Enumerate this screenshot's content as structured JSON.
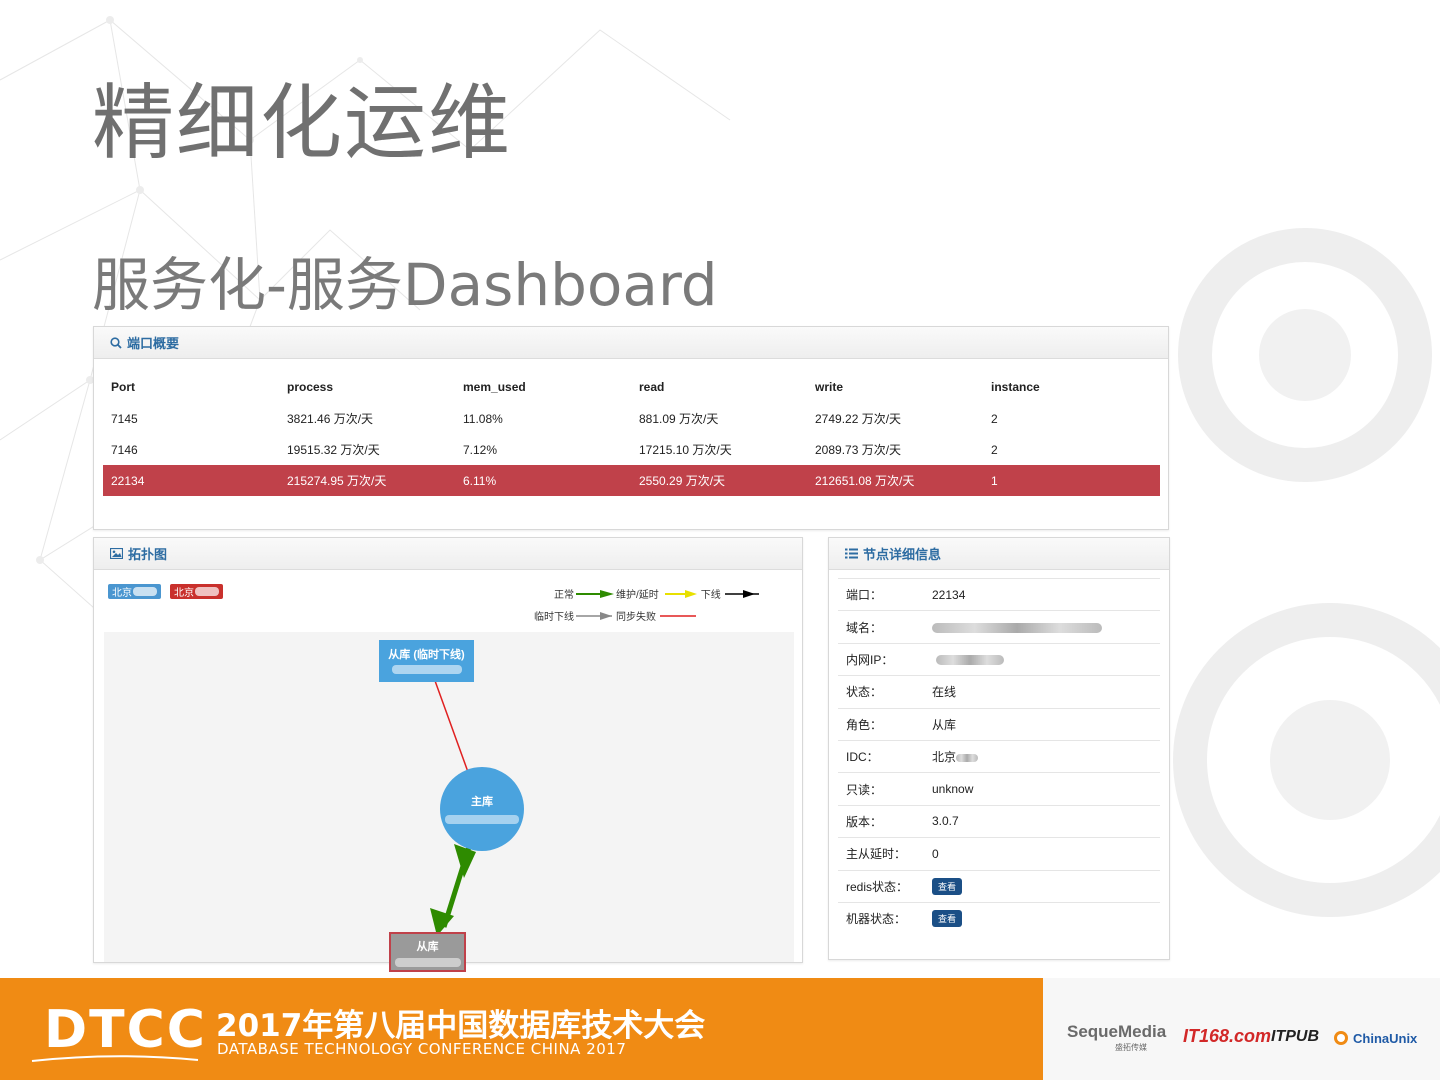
{
  "slide": {
    "title": "精细化运维",
    "subtitle": "服务化-服务Dashboard"
  },
  "port_panel": {
    "heading": "端口概要",
    "columns": [
      "Port",
      "process",
      "mem_used",
      "read",
      "write",
      "instance"
    ],
    "rows": [
      [
        "7145",
        "3821.46 万次/天",
        "11.08%",
        "881.09 万次/天",
        "2749.22 万次/天",
        "2"
      ],
      [
        "7146",
        "19515.32 万次/天",
        "7.12%",
        "17215.10 万次/天",
        "2089.73 万次/天",
        "2"
      ],
      [
        "22134",
        "215274.95 万次/天",
        "6.11%",
        "2550.29 万次/天",
        "212651.08 万次/天",
        "1"
      ]
    ],
    "highlight_color": "#c0414a"
  },
  "topology_panel": {
    "heading": "拓扑图",
    "tags": [
      {
        "label": "北京",
        "color": "#4a96d0"
      },
      {
        "label": "北京",
        "color": "#c9302c"
      }
    ],
    "legend": {
      "normal": "正常",
      "maintenance": "维护/延时",
      "offline": "下线",
      "temp_offline": "临时下线",
      "sync_fail": "同步失败"
    },
    "nodes": {
      "slave_temp": "从库 (临时下线)",
      "master": "主库",
      "slave": "从库"
    },
    "colors": {
      "normal": "#2e8b00",
      "maintenance": "#e8e000",
      "offline": "#000000",
      "temp_offline": "#888888",
      "sync_fail": "#e02020",
      "node_blue": "#4aa3de"
    }
  },
  "detail_panel": {
    "heading": "节点详细信息",
    "rows": [
      {
        "key": "端口：",
        "value": "22134"
      },
      {
        "key": "域名：",
        "value": ""
      },
      {
        "key": "内网IP：",
        "value": ""
      },
      {
        "key": "状态：",
        "value": "在线"
      },
      {
        "key": "角色：",
        "value": "从库"
      },
      {
        "key": "IDC：",
        "value": "北京"
      },
      {
        "key": "只读：",
        "value": "unknow"
      },
      {
        "key": "版本：",
        "value": "3.0.7"
      },
      {
        "key": "主从延时：",
        "value": "0"
      },
      {
        "key": "redis状态：",
        "value": "查看"
      },
      {
        "key": "机器状态：",
        "value": "查看"
      }
    ]
  },
  "footer": {
    "logo": "DTCC",
    "title": "2017年第八届中国数据库技术大会",
    "subtitle": "DATABASE  TECHNOLOGY  CONFERENCE CHINA 2017",
    "sponsors": [
      "SequeMedia",
      "盛拓传媒",
      "IT168.com",
      "ITPUB",
      "ChinaUnix"
    ],
    "accent": "#f08b14"
  }
}
